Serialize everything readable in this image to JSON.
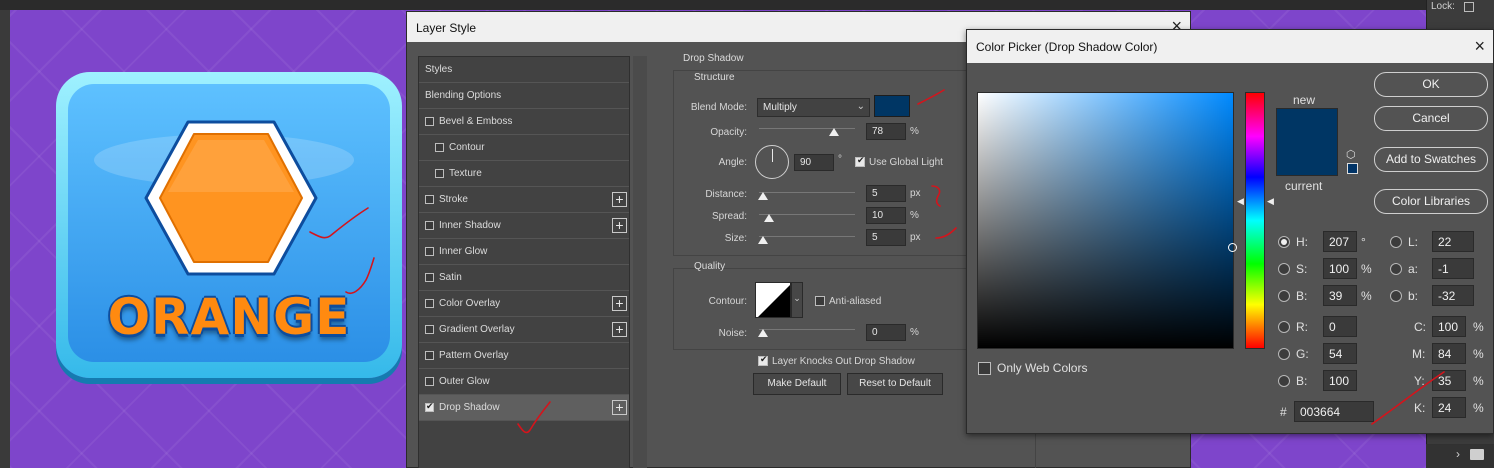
{
  "app": {
    "lock_label": "Lock:"
  },
  "artwork": {
    "button_text": "ORANGE",
    "colors": {
      "orange": "#ff8a10",
      "blue": "#2b8fe6",
      "background": "#7e45cb"
    }
  },
  "layer_style": {
    "title": "Layer Style",
    "styles": [
      {
        "label": "Styles",
        "checkbox": false,
        "checked": false,
        "indent": false,
        "plus": false,
        "selected": false
      },
      {
        "label": "Blending Options",
        "checkbox": false,
        "checked": false,
        "indent": false,
        "plus": false,
        "selected": false
      },
      {
        "label": "Bevel & Emboss",
        "checkbox": true,
        "checked": false,
        "indent": false,
        "plus": false,
        "selected": false
      },
      {
        "label": "Contour",
        "checkbox": true,
        "checked": false,
        "indent": true,
        "plus": false,
        "selected": false
      },
      {
        "label": "Texture",
        "checkbox": true,
        "checked": false,
        "indent": true,
        "plus": false,
        "selected": false
      },
      {
        "label": "Stroke",
        "checkbox": true,
        "checked": false,
        "indent": false,
        "plus": true,
        "selected": false
      },
      {
        "label": "Inner Shadow",
        "checkbox": true,
        "checked": false,
        "indent": false,
        "plus": true,
        "selected": false
      },
      {
        "label": "Inner Glow",
        "checkbox": true,
        "checked": false,
        "indent": false,
        "plus": false,
        "selected": false
      },
      {
        "label": "Satin",
        "checkbox": true,
        "checked": false,
        "indent": false,
        "plus": false,
        "selected": false
      },
      {
        "label": "Color Overlay",
        "checkbox": true,
        "checked": false,
        "indent": false,
        "plus": true,
        "selected": false
      },
      {
        "label": "Gradient Overlay",
        "checkbox": true,
        "checked": false,
        "indent": false,
        "plus": true,
        "selected": false
      },
      {
        "label": "Pattern Overlay",
        "checkbox": true,
        "checked": false,
        "indent": false,
        "plus": false,
        "selected": false
      },
      {
        "label": "Outer Glow",
        "checkbox": true,
        "checked": false,
        "indent": false,
        "plus": false,
        "selected": false
      },
      {
        "label": "Drop Shadow",
        "checkbox": true,
        "checked": true,
        "indent": false,
        "plus": true,
        "selected": true
      }
    ],
    "plus_symbol": "+",
    "drop_shadow": {
      "heading": "Drop Shadow",
      "structure_heading": "Structure",
      "blend_mode_label": "Blend Mode:",
      "blend_mode_value": "Multiply",
      "shadow_color": "#003664",
      "opacity_label": "Opacity:",
      "opacity_value": "78",
      "opacity_unit": "%",
      "opacity_level": 0.78,
      "angle_label": "Angle:",
      "angle_value": "90",
      "angle_unit": "°",
      "use_global_light_label": "Use Global Light",
      "use_global_light": true,
      "distance_label": "Distance:",
      "distance_value": "5",
      "distance_unit": "px",
      "spread_label": "Spread:",
      "spread_value": "10",
      "spread_unit": "%",
      "size_label": "Size:",
      "size_value": "5",
      "size_unit": "px",
      "quality_heading": "Quality",
      "contour_label": "Contour:",
      "anti_aliased_label": "Anti-aliased",
      "anti_aliased": false,
      "noise_label": "Noise:",
      "noise_value": "0",
      "noise_unit": "%",
      "knocks_out_label": "Layer Knocks Out Drop Shadow",
      "knocks_out": true,
      "make_default_label": "Make Default",
      "reset_default_label": "Reset to Default"
    }
  },
  "color_picker": {
    "title": "Color Picker (Drop Shadow Color)",
    "ok_label": "OK",
    "cancel_label": "Cancel",
    "add_swatches_label": "Add to Swatches",
    "color_libraries_label": "Color Libraries",
    "new_label": "new",
    "current_label": "current",
    "new_color": "#003664",
    "current_color": "#003664",
    "only_web_colors_label": "Only Web Colors",
    "only_web_colors": false,
    "hsb": [
      {
        "label": "H:",
        "value": "207",
        "unit": "°",
        "selected": true
      },
      {
        "label": "S:",
        "value": "100",
        "unit": "%",
        "selected": false
      },
      {
        "label": "B:",
        "value": "39",
        "unit": "%",
        "selected": false
      }
    ],
    "rgb": [
      {
        "label": "R:",
        "value": "0"
      },
      {
        "label": "G:",
        "value": "54"
      },
      {
        "label": "B:",
        "value": "100"
      }
    ],
    "lab": [
      {
        "label": "L:",
        "value": "22"
      },
      {
        "label": "a:",
        "value": "-1"
      },
      {
        "label": "b:",
        "value": "-32"
      }
    ],
    "cmyk": [
      {
        "label": "C:",
        "value": "100",
        "unit": "%"
      },
      {
        "label": "M:",
        "value": "84",
        "unit": "%"
      },
      {
        "label": "Y:",
        "value": "35",
        "unit": "%"
      },
      {
        "label": "K:",
        "value": "24",
        "unit": "%"
      }
    ],
    "hex_label": "#",
    "hex_value": "003664",
    "field_hue_color": "#008aff"
  }
}
